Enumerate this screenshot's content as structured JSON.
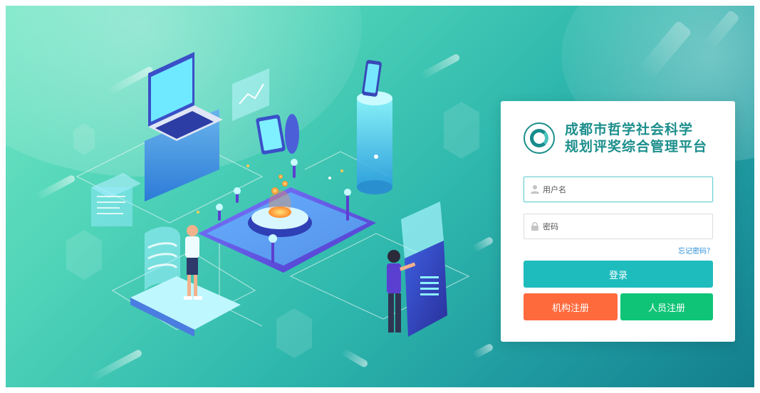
{
  "brand": {
    "title_line1": "成都市哲学社会科学",
    "title_line2": "规划评奖综合管理平台",
    "logo_icon": "emblem-logo"
  },
  "login_form": {
    "username_placeholder": "用户名",
    "username_icon": "user-icon",
    "password_placeholder": "密码",
    "password_icon": "lock-icon",
    "forgot_password_label": "忘记密码？",
    "login_button_label": "登录",
    "org_register_label": "机构注册",
    "person_register_label": "人员注册"
  },
  "colors": {
    "primary": "#1fbcbe",
    "org_register": "#ff6a3d",
    "person_register": "#10c477",
    "brand_text": "#1c8f8c",
    "link": "#2d8fd6"
  }
}
